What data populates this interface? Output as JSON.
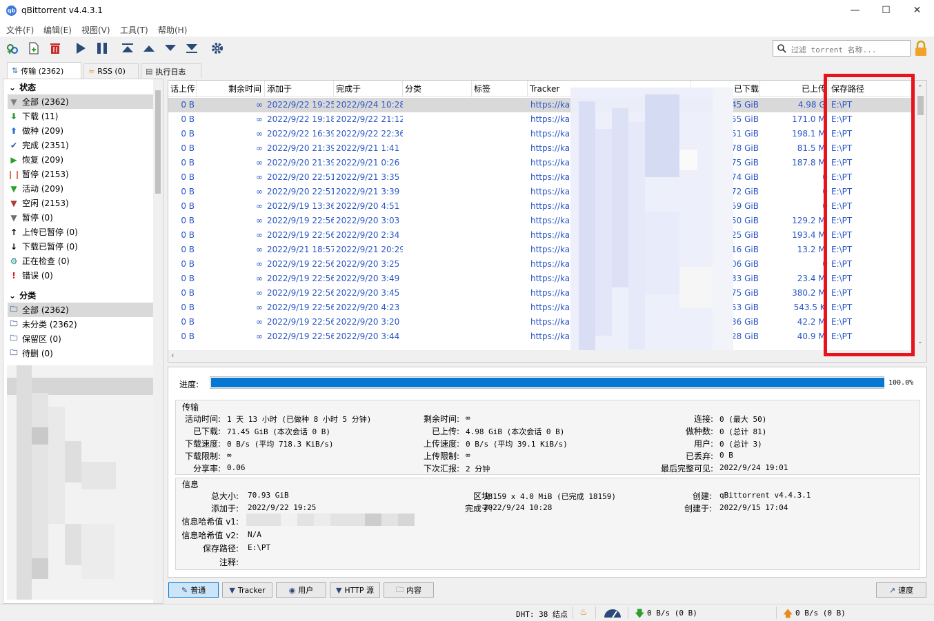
{
  "window": {
    "title": "qBittorrent v4.4.3.1",
    "app_icon": "qb"
  },
  "menu": [
    "文件(F)",
    "编辑(E)",
    "视图(V)",
    "工具(T)",
    "帮助(H)"
  ],
  "toolbar": {
    "icons": [
      "add-link-icon",
      "add-file-icon",
      "delete-icon",
      "resume-icon",
      "pause-icon",
      "move-top-icon",
      "move-up-icon",
      "move-down-icon",
      "move-bottom-icon",
      "options-gear-icon"
    ],
    "search_placeholder": "过滤 torrent 名称...",
    "lock_icon": "lock-icon"
  },
  "left_tabs": [
    {
      "label": "传输 (2362)",
      "icon": "transfer-icon",
      "active": true
    },
    {
      "label": "RSS (0)",
      "icon": "rss-icon",
      "active": false
    },
    {
      "label": "执行日志",
      "icon": "log-icon",
      "active": false
    }
  ],
  "sidebar": {
    "status_header": "状态",
    "status_items": [
      {
        "label": "全部 (2362)",
        "icon": "filter-all-icon",
        "color": "#808080",
        "selected": true
      },
      {
        "label": "下载 (11)",
        "icon": "arrow-down-icon",
        "color": "#2e9e2e",
        "selected": false
      },
      {
        "label": "做种 (209)",
        "icon": "arrow-up-icon",
        "color": "#2a6fd6",
        "selected": false
      },
      {
        "label": "完成 (2351)",
        "icon": "checkmark-icon",
        "color": "#2f5aa8",
        "selected": false
      },
      {
        "label": "恢复 (209)",
        "icon": "play-icon",
        "color": "#2e9e2e",
        "selected": false
      },
      {
        "label": "暂停 (2153)",
        "icon": "pause-icon",
        "color": "#e07060",
        "selected": false
      },
      {
        "label": "活动 (209)",
        "icon": "filter-active-icon",
        "color": "#2e9e2e",
        "selected": false
      },
      {
        "label": "空闲 (2153)",
        "icon": "filter-inactive-icon",
        "color": "#b03a3a",
        "selected": false
      },
      {
        "label": "暂停 (0)",
        "icon": "filter-stalled-icon",
        "color": "#707070",
        "selected": false
      },
      {
        "label": "上传已暂停 (0)",
        "icon": "arrow-up-black-icon",
        "color": "#000000",
        "selected": false
      },
      {
        "label": "下载已暂停 (0)",
        "icon": "arrow-down-black-icon",
        "color": "#000000",
        "selected": false
      },
      {
        "label": "正在检查 (0)",
        "icon": "gear-teal-icon",
        "color": "#1a8a8a",
        "selected": false
      },
      {
        "label": "错误 (0)",
        "icon": "error-exclamation-icon",
        "color": "#e01010",
        "selected": false
      }
    ],
    "category_header": "分类",
    "category_items": [
      {
        "label": "全部 (2362)",
        "icon": "folder-icon",
        "selected": true
      },
      {
        "label": "未分类 (2362)",
        "icon": "folder-icon",
        "selected": false
      },
      {
        "label": "保留区 (0)",
        "icon": "folder-icon",
        "selected": false
      },
      {
        "label": "待删 (0)",
        "icon": "folder-icon",
        "selected": false
      }
    ]
  },
  "table": {
    "columns": [
      "话上传",
      "剩余时间",
      "添加于",
      "完成于",
      "分类",
      "标签",
      "Tracker",
      "已下载",
      "已上传",
      "保存路径"
    ],
    "rows": [
      {
        "up": "0 B",
        "eta": "∞",
        "added": "2022/9/22 19:25",
        "done": "2022/9/24 10:28",
        "tracker": "https://ka",
        "dl": "45 GiB",
        "ul": "4.98 Gi",
        "path": "E:\\PT",
        "selected": true
      },
      {
        "up": "0 B",
        "eta": "∞",
        "added": "2022/9/22 19:18",
        "done": "2022/9/22 21:12",
        "tracker": "https://ka",
        "dl": "55 GiB",
        "ul": "171.0 Mi",
        "path": "E:\\PT"
      },
      {
        "up": "0 B",
        "eta": "∞",
        "added": "2022/9/22 16:39",
        "done": "2022/9/22 22:36",
        "tracker": "https://ka",
        "dl": "51 GiB",
        "ul": "198.1 Mi",
        "path": "E:\\PT"
      },
      {
        "up": "0 B",
        "eta": "∞",
        "added": "2022/9/20 21:39",
        "done": "2022/9/21 1:41",
        "tracker": "https://ka",
        "dl": "78 GiB",
        "ul": "81.5 Mi",
        "path": "E:\\PT"
      },
      {
        "up": "0 B",
        "eta": "∞",
        "added": "2022/9/20 21:39",
        "done": "2022/9/21 0:26",
        "tracker": "https://ka",
        "dl": "75 GiB",
        "ul": "187.8 Mi",
        "path": "E:\\PT"
      },
      {
        "up": "0 B",
        "eta": "∞",
        "added": "2022/9/20 22:51",
        "done": "2022/9/21 3:35",
        "tracker": "https://ka",
        "dl": "74 GiB",
        "ul": "0",
        "path": "E:\\PT"
      },
      {
        "up": "0 B",
        "eta": "∞",
        "added": "2022/9/20 22:51",
        "done": "2022/9/21 3:39",
        "tracker": "https://ka",
        "dl": "72 GiB",
        "ul": "0",
        "path": "E:\\PT"
      },
      {
        "up": "0 B",
        "eta": "∞",
        "added": "2022/9/19 13:36",
        "done": "2022/9/20 4:51",
        "tracker": "https://ka",
        "dl": "59 GiB",
        "ul": "0",
        "path": "E:\\PT"
      },
      {
        "up": "0 B",
        "eta": "∞",
        "added": "2022/9/19 22:56",
        "done": "2022/9/20 3:03",
        "tracker": "https://ka",
        "dl": "50 GiB",
        "ul": "129.2 Mi",
        "path": "E:\\PT"
      },
      {
        "up": "0 B",
        "eta": "∞",
        "added": "2022/9/19 22:56",
        "done": "2022/9/20 2:34",
        "tracker": "https://ka",
        "dl": "25 GiB",
        "ul": "193.4 Mi",
        "path": "E:\\PT"
      },
      {
        "up": "0 B",
        "eta": "∞",
        "added": "2022/9/21 18:57",
        "done": "2022/9/21 20:29",
        "tracker": "https://ka",
        "dl": "16 GiB",
        "ul": "13.2 Mi",
        "path": "E:\\PT"
      },
      {
        "up": "0 B",
        "eta": "∞",
        "added": "2022/9/19 22:56",
        "done": "2022/9/20 3:25",
        "tracker": "https://ka",
        "dl": "06 GiB",
        "ul": "0",
        "path": "E:\\PT"
      },
      {
        "up": "0 B",
        "eta": "∞",
        "added": "2022/9/19 22:56",
        "done": "2022/9/20 3:49",
        "tracker": "https://ka",
        "dl": "33 GiB",
        "ul": "23.4 Mi",
        "path": "E:\\PT"
      },
      {
        "up": "0 B",
        "eta": "∞",
        "added": "2022/9/19 22:56",
        "done": "2022/9/20 3:45",
        "tracker": "https://ka",
        "dl": "75 GiB",
        "ul": "380.2 Mi",
        "path": "E:\\PT"
      },
      {
        "up": "0 B",
        "eta": "∞",
        "added": "2022/9/19 22:56",
        "done": "2022/9/20 4:23",
        "tracker": "https://ka",
        "dl": "53 GiB",
        "ul": "543.5 Ki",
        "path": "E:\\PT"
      },
      {
        "up": "0 B",
        "eta": "∞",
        "added": "2022/9/19 22:56",
        "done": "2022/9/20 3:20",
        "tracker": "https://ka",
        "dl": "36 GiB",
        "ul": "42.2 Mi",
        "path": "E:\\PT"
      },
      {
        "up": "0 B",
        "eta": "∞",
        "added": "2022/9/19 22:56",
        "done": "2022/9/20 3:44",
        "tracker": "https://ka",
        "dl": "28 GiB",
        "ul": "40.9 Mi",
        "path": "E:\\PT"
      }
    ],
    "highlight_color": "#e8141b"
  },
  "details": {
    "progress_label": "进度:",
    "progress_value": 1.0,
    "progress_text": "100.0%",
    "transfer": {
      "title": "传输",
      "active_time_k": "活动时间:",
      "active_time_v": "1 天 13 小时 (已做种 8 小时 5 分钟)",
      "downloaded_k": "已下载:",
      "downloaded_v": "71.45 GiB (本次会话 0 B)",
      "dl_speed_k": "下载速度:",
      "dl_speed_v": "0 B/s (平均 718.3 KiB/s)",
      "dl_limit_k": "下载限制:",
      "dl_limit_v": "∞",
      "ratio_k": "分享率:",
      "ratio_v": "0.06",
      "eta_k": "剩余时间:",
      "eta_v": "∞",
      "uploaded_k": "已上传:",
      "uploaded_v": "4.98 GiB (本次会话 0 B)",
      "ul_speed_k": "上传速度:",
      "ul_speed_v": "0 B/s (平均 39.1 KiB/s)",
      "ul_limit_k": "上传限制:",
      "ul_limit_v": "∞",
      "reannounce_k": "下次汇报:",
      "reannounce_v": "2 分钟",
      "connections_k": "连接:",
      "connections_v": "0 (最大 50)",
      "seeds_k": "做种数:",
      "seeds_v": "0 (总计 81)",
      "peers_k": "用户:",
      "peers_v": "0 (总计 3)",
      "wasted_k": "已丢弃:",
      "wasted_v": "0 B",
      "last_seen_k": "最后完整可见:",
      "last_seen_v": "2022/9/24 19:01"
    },
    "info": {
      "title": "信息",
      "total_size_k": "总大小:",
      "total_size_v": "70.93 GiB",
      "added_k": "添加于:",
      "added_v": "2022/9/22 19:25",
      "hash_v1_k": "信息哈希值 v1:",
      "hash_v2_k": "信息哈希值 v2:",
      "hash_v2_v": "N/A",
      "save_path_k": "保存路径:",
      "save_path_v": "E:\\PT",
      "comment_k": "注释:",
      "pieces_k": "区块:",
      "pieces_v": "18159 x 4.0 MiB (已完成 18159)",
      "completed_k": "完成于:",
      "completed_v": "2022/9/24 10:28",
      "created_by_k": "创建:",
      "created_by_v": "qBittorrent v4.4.3.1",
      "created_on_k": "创建于:",
      "created_on_v": "2022/9/15 17:04"
    }
  },
  "bottom_tabs": [
    {
      "label": "普通",
      "icon": "general-icon",
      "active": true
    },
    {
      "label": "Tracker",
      "icon": "tracker-icon",
      "active": false
    },
    {
      "label": "用户",
      "icon": "peers-icon",
      "active": false
    },
    {
      "label": "HTTP 源",
      "icon": "http-source-icon",
      "active": false
    },
    {
      "label": "内容",
      "icon": "content-folder-icon",
      "active": false
    }
  ],
  "speed_tab": {
    "label": "速度",
    "icon": "speed-chart-icon"
  },
  "statusbar": {
    "dht": "DHT: 38 结点",
    "down": "0 B/s (0 B)",
    "up": "0 B/s (0 B)"
  }
}
